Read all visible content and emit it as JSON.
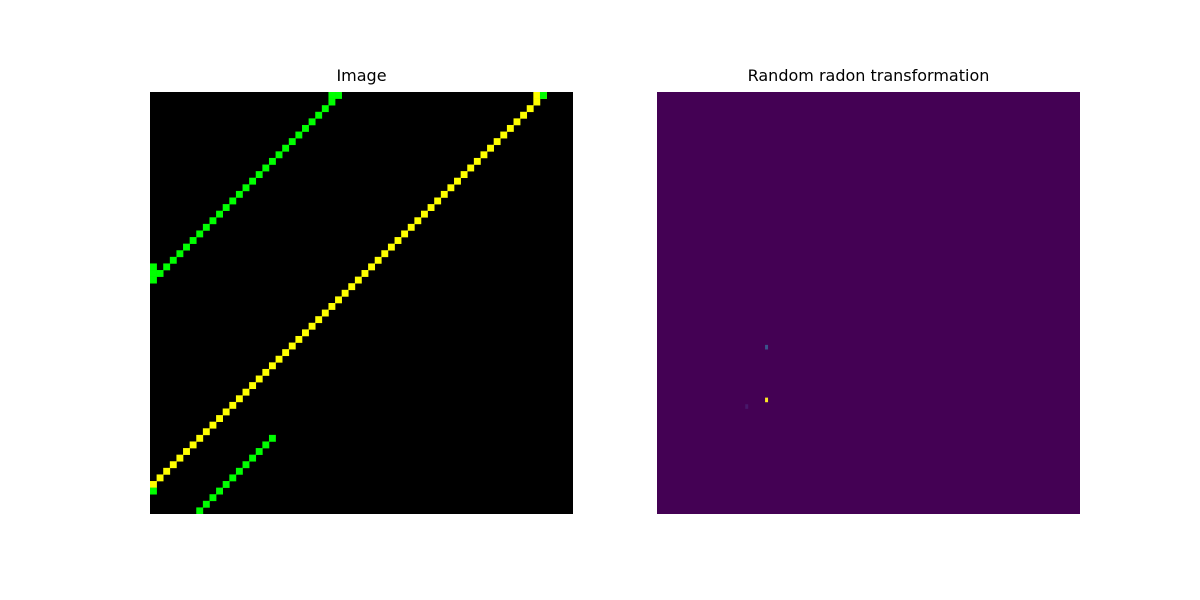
{
  "chart_data": [
    {
      "type": "heatmap",
      "title": "Image",
      "grid": false,
      "axes_visible": false,
      "grid_size": [
        64,
        64
      ],
      "colors": {
        "background": "#000000",
        "line_a": "#00ff00",
        "line_b": "#ffff00"
      },
      "series": [
        {
          "name": "",
          "color": "#00ff00",
          "from": [
            0,
            28
          ],
          "to": [
            28,
            0
          ]
        },
        {
          "name": "",
          "color": "#ffff00",
          "from": [
            0,
            59
          ],
          "to": [
            59,
            0
          ]
        },
        {
          "name": "",
          "color": "#00ff00",
          "from": [
            7,
            63
          ],
          "to": [
            18,
            52
          ]
        }
      ],
      "extra_cells": [
        {
          "col": 0,
          "row": 26,
          "color": "#00ff00"
        },
        {
          "col": 0,
          "row": 27,
          "color": "#00ff00"
        },
        {
          "col": 0,
          "row": 60,
          "color": "#00ff00"
        },
        {
          "col": 27,
          "row": 0,
          "color": "#00ff00"
        },
        {
          "col": 58,
          "row": 0,
          "color": "#ffff00"
        },
        {
          "col": 59,
          "row": 0,
          "color": "#00ff00"
        }
      ]
    },
    {
      "type": "heatmap",
      "title": "Random radon transformation",
      "grid": false,
      "axes_visible": false,
      "grid_size": [
        64,
        64
      ],
      "colors": {
        "background": "#440154"
      },
      "cells": [
        {
          "col": 16,
          "row": 38,
          "color": "#3b528b"
        },
        {
          "col": 16,
          "row": 46,
          "color": "#fde725"
        },
        {
          "col": 13,
          "row": 47,
          "color": "#48186a"
        }
      ]
    }
  ]
}
